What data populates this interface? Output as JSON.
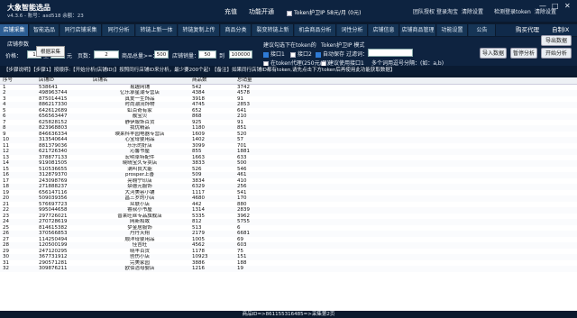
{
  "app": {
    "title": "大象智能选品",
    "subtitle": "v4.3.6 - 账号：asd518 余额：23"
  },
  "top": {
    "recharge": "充值",
    "feature_toggle": "功能开通",
    "token_label": "Token护卫IP 58元/月",
    "token_extra": "(0元)",
    "right_links": [
      "团队授权",
      "登录淘宝",
      "清除设置",
      "检测登录token",
      "清除设置"
    ],
    "window_controls": [
      "—",
      "□",
      "✕"
    ]
  },
  "nav": {
    "tabs": [
      "店铺采集",
      "智能选品",
      "同行店铺采集",
      "同行分析",
      "转链上新一体",
      "转链复制上传",
      "商品分类",
      "裂变转链上新",
      "机会商品分析",
      "词性分析",
      "店铺信息",
      "店铺商品管理",
      "功能设置",
      "公告"
    ],
    "right": [
      "购买代理",
      "自制IX"
    ]
  },
  "settings": {
    "section_title": "店铺参数",
    "price_label": "价格：",
    "price_min": "1",
    "price_to": "至",
    "price_max": "5",
    "price_unit": "元",
    "pages_label": "页数：",
    "pages_value": "2",
    "sales_label": "商品总量>=：",
    "sales_value": "500",
    "shop_sales_label": "店铺销量：",
    "shop_sales_min": "50",
    "shop_sales_to": "到",
    "shop_sales_max": "100000",
    "token_option": "建议勾选下在token的",
    "token_guard": "Token护卫IP 模式",
    "interface_1": "接口1",
    "interface_2": "接口2",
    "auto_save": "自动保存",
    "filter": "过滤词：",
    "proxy_note": "在token代理(250元/月)",
    "cmd_note": "建议使用接口1",
    "multi_note": "多个词用逗号分隔：(如：a,b)",
    "buttons": [
      "导入数据",
      "暂停分析",
      "开始分析",
      "导出数据"
    ],
    "tooltip": "根据采集"
  },
  "banner": "【步骤说明】【步骤1】按顺序:【开始分析(店铺ID)】按照同行店铺ID来分析，最少要200个起! 【备注】如果同行店铺ID都有token,请先点击下方token后再使用此功能获取数据】",
  "table": {
    "headers": [
      "序号",
      "店铺ID",
      "店铺名",
      "商品数",
      "总销量"
    ],
    "rows": [
      [
        "1",
        "538641",
        "易趣网铺",
        "542",
        "3742"
      ],
      [
        "2",
        "498963744",
        "亿乐承星潮专营店",
        "4384",
        "4578"
      ],
      [
        "3",
        "875014415",
        "真爱一生饰品",
        "3918",
        "91"
      ],
      [
        "4",
        "886217330",
        "时尚潮流饰物",
        "4745",
        "2853"
      ],
      [
        "5",
        "642612689",
        "虹百奇有家",
        "652",
        "641"
      ],
      [
        "6",
        "656563447",
        "靓宝贝",
        "868",
        "210"
      ],
      [
        "7",
        "625828152",
        "静伊服饰百货",
        "925",
        "91"
      ],
      [
        "8",
        "823968803",
        "我优精品",
        "1180",
        "851"
      ],
      [
        "9",
        "846636334",
        "映莱科丰园电器专营店",
        "1609",
        "520"
      ],
      [
        "10",
        "313540644",
        "心宝母婴用品",
        "1402",
        "57"
      ],
      [
        "11",
        "881379036",
        "乐乐的好店",
        "3099",
        "701"
      ],
      [
        "12",
        "621726340",
        "沁馨书屋",
        "855",
        "1881"
      ],
      [
        "13",
        "378877133",
        "宏明卓特配件",
        "1663",
        "633"
      ],
      [
        "14",
        "919081505",
        "晓晴宝久专卖店",
        "3833",
        "500"
      ],
      [
        "15",
        "510536655",
        "满叫良大能",
        "526",
        "546"
      ],
      [
        "16",
        "312879370",
        "prosper上善",
        "509",
        "461"
      ],
      [
        "17",
        "243098769",
        "亮翱宁印店",
        "3834",
        "410"
      ],
      [
        "18",
        "271888237",
        "禁德元服饰",
        "6329",
        "256"
      ],
      [
        "19",
        "656147116",
        "大河美容小铺",
        "1117",
        "541"
      ],
      [
        "20",
        "509039356",
        "昌三岁的小店",
        "4680",
        "170"
      ],
      [
        "21",
        "576697723",
        "众联小店",
        "442",
        "880"
      ],
      [
        "22",
        "995044658",
        "睿叔小书屋",
        "1314",
        "2839"
      ],
      [
        "23",
        "297726021",
        "普莱旺丝专品旗舰店",
        "5335",
        "3962"
      ],
      [
        "24",
        "270728619",
        "网新和致",
        "812",
        "5755"
      ],
      [
        "25",
        "814615382",
        "梦金居服饰",
        "513",
        "6"
      ],
      [
        "26",
        "370566853",
        "丹丹天翔",
        "2179",
        "6681"
      ],
      [
        "27",
        "114250494",
        "顺洋母婴用品",
        "1005",
        "69"
      ],
      [
        "28",
        "120500199",
        "佳吉旺",
        "4562",
        "603"
      ],
      [
        "29",
        "247120295",
        "晓丰百货",
        "1178",
        "75"
      ],
      [
        "30",
        "367731912",
        "创伤小店",
        "10923",
        "151"
      ],
      [
        "31",
        "290571281",
        "完美家园",
        "3886",
        "188"
      ],
      [
        "32",
        "309876211",
        "欧佰洁母婴店",
        "1216",
        "19"
      ]
    ]
  },
  "status": "商品ID=>861155316485=>采集第2页"
}
